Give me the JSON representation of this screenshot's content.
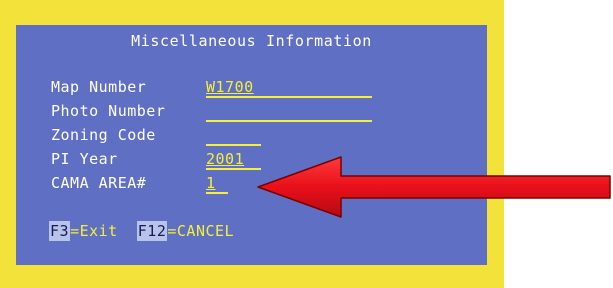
{
  "screen": {
    "title": "Miscellaneous Information"
  },
  "fields": {
    "map_number": {
      "label": "Map Number",
      "value": "W1700"
    },
    "photo_number": {
      "label": "Photo Number",
      "value": ""
    },
    "zoning_code": {
      "label": "Zoning Code",
      "value": ""
    },
    "pi_year": {
      "label": "PI Year",
      "value": "2001"
    },
    "cama_area": {
      "label": "CAMA AREA#",
      "value": "1"
    }
  },
  "function_keys": {
    "exit": {
      "key": "F3",
      "label": "=Exit"
    },
    "cancel": {
      "key": "F12",
      "label": "=CANCEL"
    }
  },
  "colors": {
    "frame": "#f2e23a",
    "screen_background": "#5f6fc4",
    "field_text": "#f5ef3a",
    "label_text": "#ffffff",
    "arrow": "#e8101a"
  },
  "annotation": {
    "arrow_icon": "red-arrow-pointing-left"
  }
}
